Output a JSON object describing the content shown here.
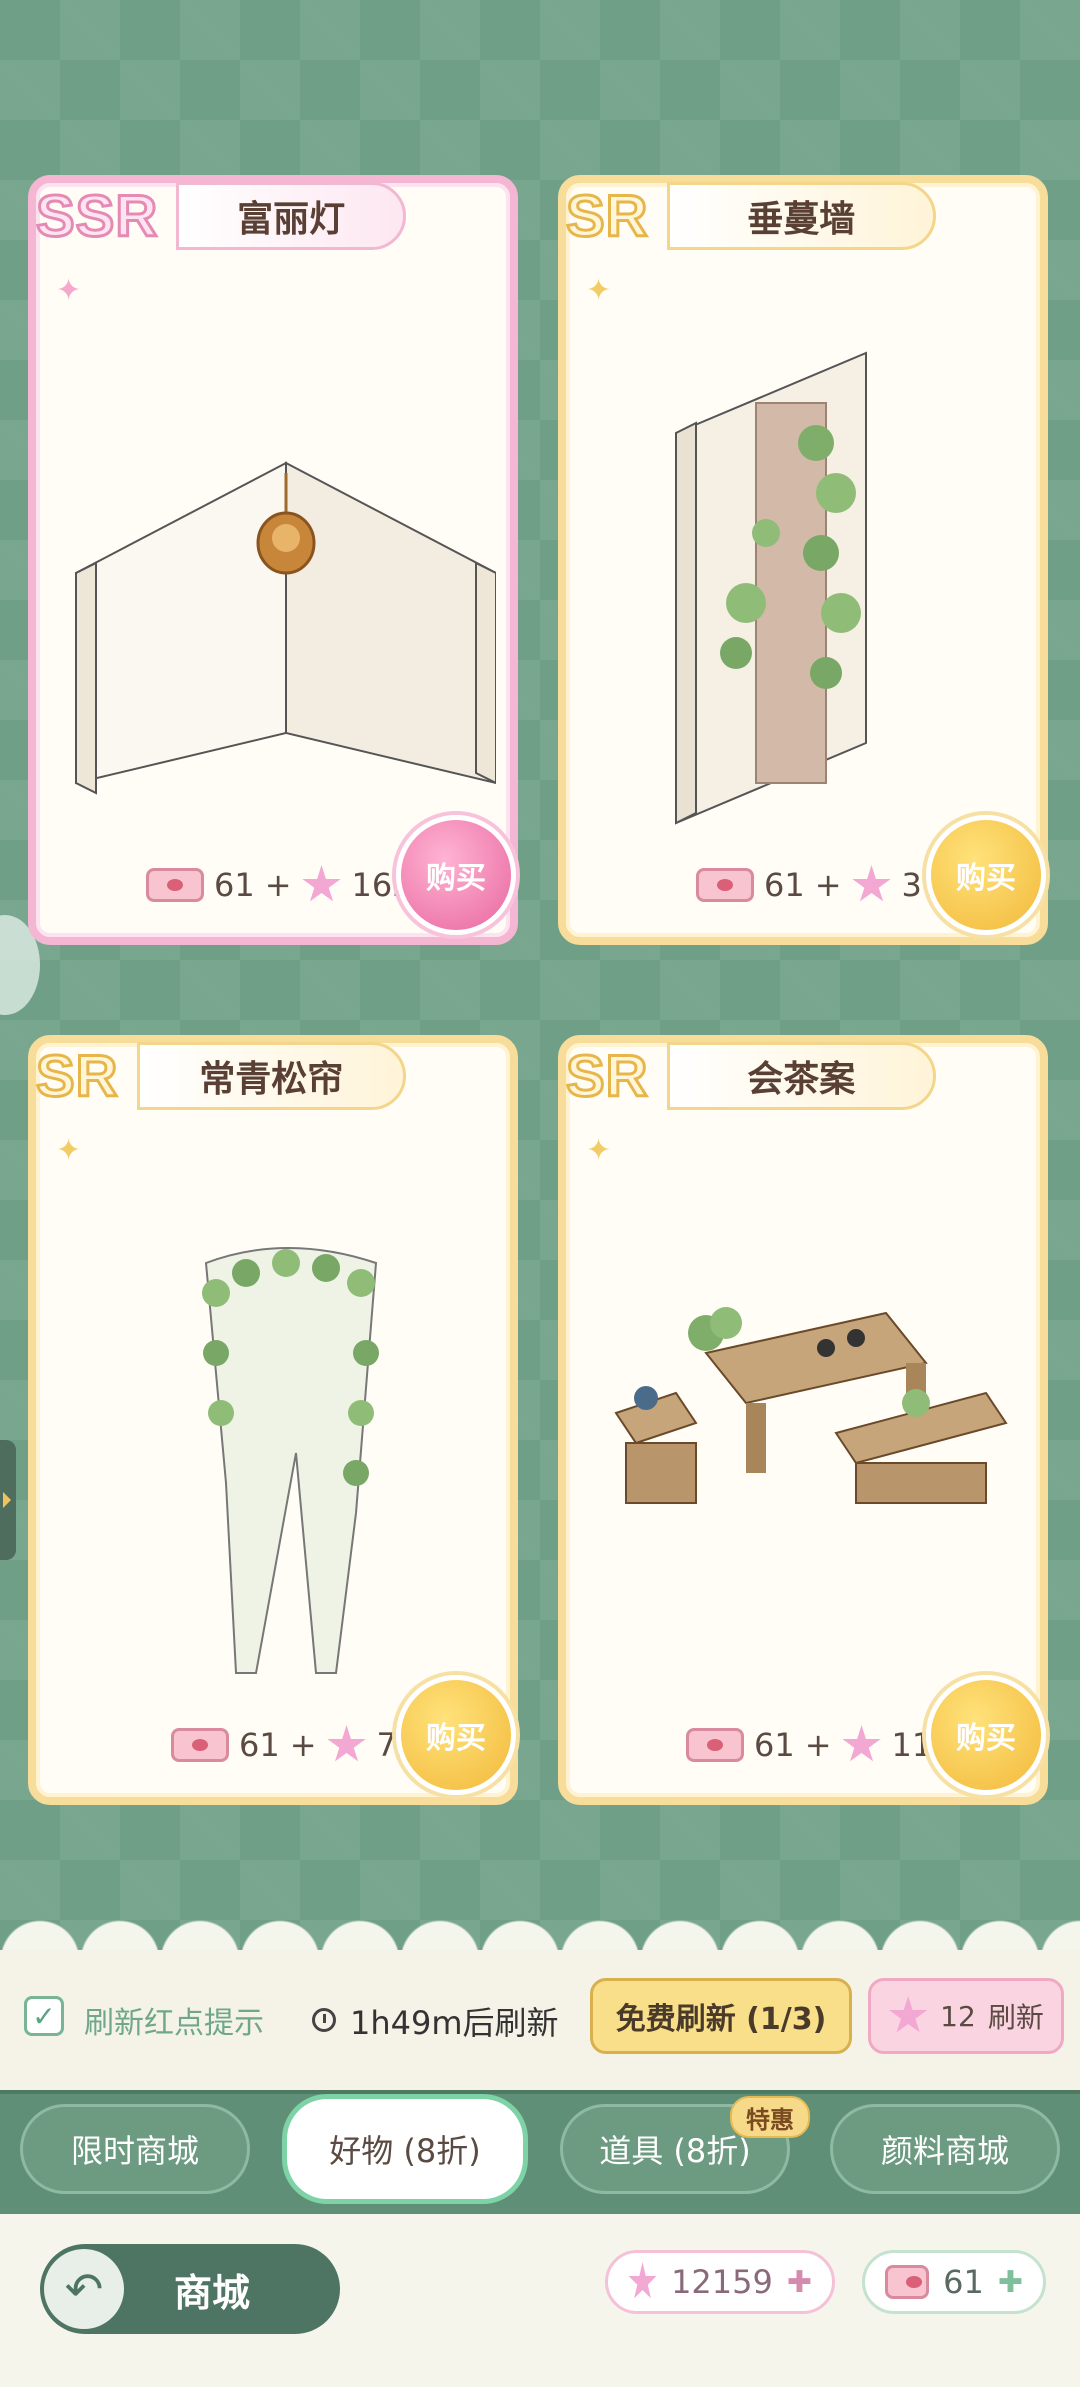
{
  "cards": [
    {
      "rarity": "SSR",
      "name": "富丽灯",
      "price_ticket": "61",
      "price_star": "162",
      "buy": "购买"
    },
    {
      "rarity": "SR",
      "name": "垂蔓墙",
      "price_ticket": "61",
      "price_star": "31",
      "buy": "购买"
    },
    {
      "rarity": "SR",
      "name": "常青松帘",
      "price_ticket": "61",
      "price_star": "72",
      "buy": "购买"
    },
    {
      "rarity": "SR",
      "name": "会茶案",
      "price_ticket": "61",
      "price_star": "117",
      "buy": "购买"
    }
  ],
  "refresh": {
    "checkbox_label": "刷新红点提示",
    "timer": "1h49m后刷新",
    "free": "免费刷新 (1/3)",
    "paid_cost": "12",
    "paid_label": "刷新"
  },
  "tabs": [
    {
      "label": "限时商城"
    },
    {
      "label": "好物 (8折)"
    },
    {
      "label": "道具 (8折)"
    },
    {
      "label": "颜料商城"
    }
  ],
  "badge": "特惠",
  "footer": {
    "title": "商城",
    "stars": "12159",
    "tickets": "61"
  },
  "colors": {
    "ssr": "#f5b6d3",
    "sr": "#f7dc9a",
    "bg": "#6f9f86",
    "tabbar": "#5f8f76"
  }
}
